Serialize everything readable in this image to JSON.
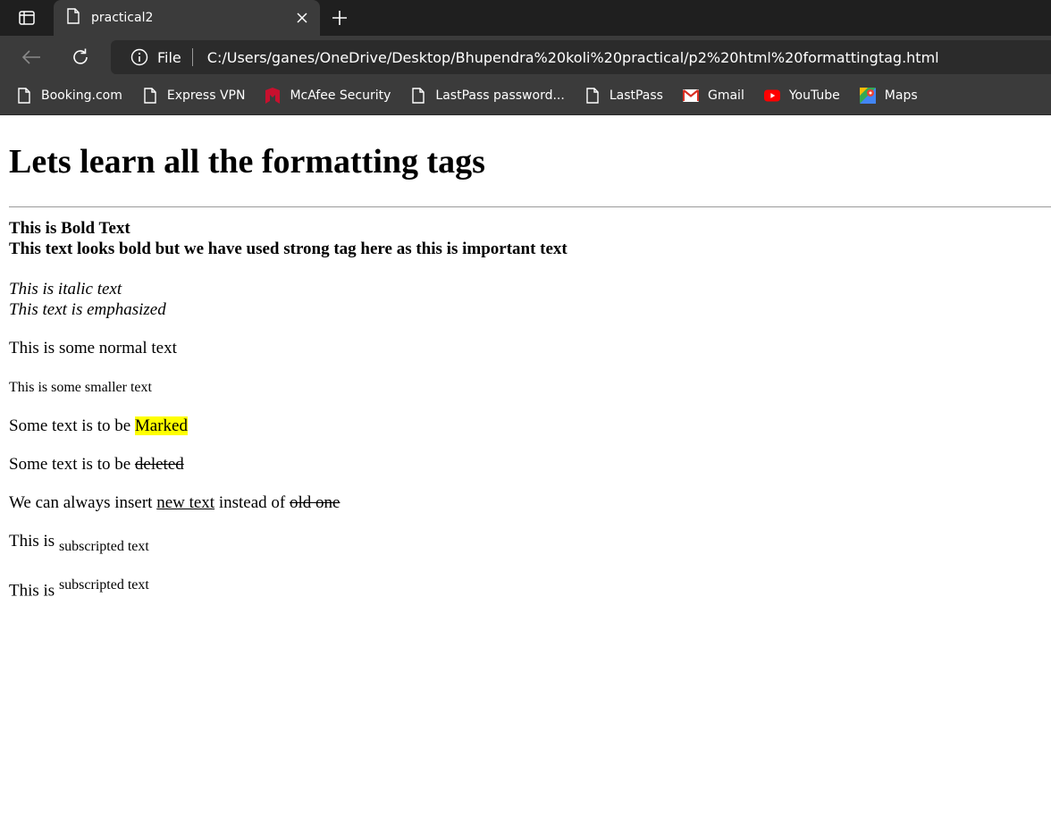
{
  "browser": {
    "tab_title": "practical2",
    "address_scheme": "File",
    "url": "C:/Users/ganes/OneDrive/Desktop/Bhupendra%20koli%20practical/p2%20html%20formattingtag.html",
    "bookmarks": [
      {
        "label": "Booking.com",
        "icon": "page-icon"
      },
      {
        "label": "Express VPN",
        "icon": "page-icon"
      },
      {
        "label": "McAfee Security",
        "icon": "mcafee-icon"
      },
      {
        "label": "LastPass password...",
        "icon": "page-icon"
      },
      {
        "label": "LastPass",
        "icon": "page-icon"
      },
      {
        "label": "Gmail",
        "icon": "gmail-icon"
      },
      {
        "label": "YouTube",
        "icon": "youtube-icon"
      },
      {
        "label": "Maps",
        "icon": "maps-icon"
      }
    ]
  },
  "page": {
    "heading": "Lets learn all the formatting tags",
    "bold": "This is Bold Text",
    "strong": "This text looks bold but we have used strong tag here as this is important text",
    "italic": "This is italic text",
    "emphasized": "This text is emphasized",
    "normal": "This is some normal text",
    "small": "This is some smaller text",
    "mark_prefix": "Some text is to be ",
    "mark_text": "Marked",
    "del_prefix": "Some text is to be ",
    "del_text": "deleted",
    "ins_prefix": "We can always insert ",
    "ins_text": "new text",
    "ins_middle": " instead of ",
    "ins_old": "old one",
    "sub_prefix": "This is ",
    "sub_text": "subscripted text",
    "sup_prefix": "This is ",
    "sup_text": "subscripted text"
  },
  "colors": {
    "chrome_dark": "#1f1f1f",
    "chrome": "#3b3b3b",
    "mark": "#ffff00"
  }
}
